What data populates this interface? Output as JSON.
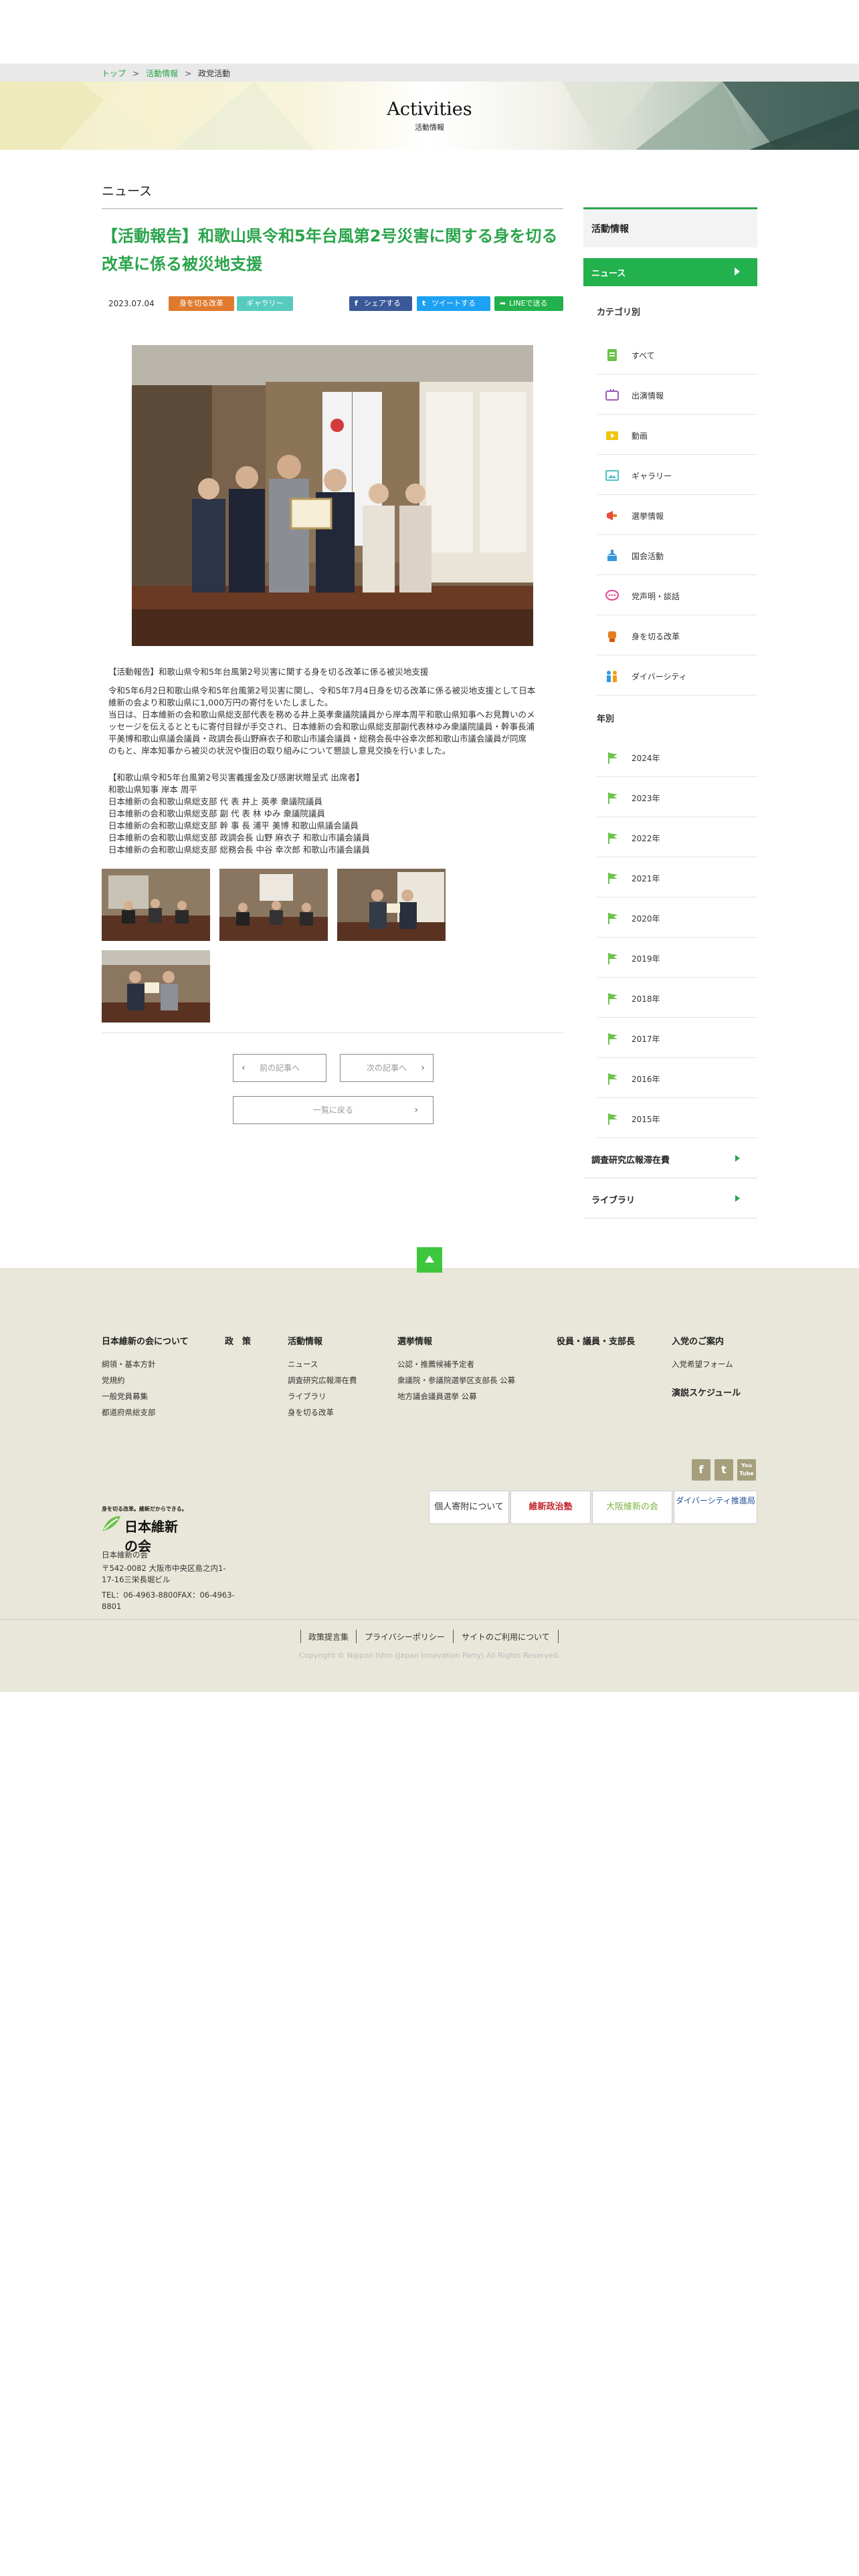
{
  "breadcrumb": {
    "home": "トップ",
    "activities": "活動情報",
    "current": "政党活動",
    "separator": ">"
  },
  "hero": {
    "title": "Activities",
    "subtitle": "活動情報"
  },
  "section_title": "ニュース",
  "article": {
    "title": "【活動報告】和歌山県令和5年台風第2号災害に関する身を切る改革に係る被災地支援",
    "date": "2023.07.04",
    "tags": [
      "身を切る改革",
      "ギャラリー"
    ],
    "share": {
      "facebook": "シェアする",
      "twitter": "ツイートする",
      "line": "LINEで送る"
    },
    "caption": "【活動報告】和歌山県令和5年台風第2号災害に関する身を切る改革に係る被災地支援",
    "paragraph": [
      "令和5年6月2日和歌山県令和5年台風第2号災害に関し、令和5年7月4日身を切る改革に係る被災地支援として日本",
      "維新の会より和歌山県に1,000万円の寄付をいたしました。",
      "当日は、日本維新の会和歌山県総支部代表を務める井上英孝衆議院議員から岸本周平和歌山県知事へお見舞いのメ",
      "ッセージを伝えるとともに寄付目録が手交され、日本維新の会和歌山県総支部副代表林ゆみ衆議院議員・幹事長浦",
      "平美博和歌山県議会議員・政調会長山野麻衣子和歌山市議会議員・総務会長中谷幸次郎和歌山市議会議員が同席",
      "のもと、岸本知事から被災の状況や復旧の取り組みについて懇談し意見交換を行いました。"
    ],
    "attendees": [
      "【和歌山県令和5年台風第2号災害義援金及び感謝状贈呈式 出席者】",
      "和歌山県知事 岸本 周平",
      "日本維新の会和歌山県総支部 代 表 井上 英孝 衆議院議員",
      "日本維新の会和歌山県総支部 副 代 表 林 ゆみ 衆議院議員",
      "日本維新の会和歌山県総支部 幹 事 長 浦平 美博 和歌山県議会議員",
      "日本維新の会和歌山県総支部 政調会長 山野 麻衣子 和歌山市議会議員",
      "日本維新の会和歌山県総支部 総務会長 中谷 幸次郎 和歌山市議会議員"
    ]
  },
  "pager": {
    "prev": "前の記事へ",
    "next": "次の記事へ",
    "list": "一覧に戻る"
  },
  "sidebar": {
    "heading": "活動情報",
    "news": "ニュース",
    "by_category": "カテゴリ別",
    "categories": [
      "すべて",
      "出演情報",
      "動画",
      "ギャラリー",
      "選挙情報",
      "国会活動",
      "党声明・談話",
      "身を切る改革",
      "ダイバーシティ"
    ],
    "by_year": "年別",
    "years": [
      "2024年",
      "2023年",
      "2022年",
      "2021年",
      "2020年",
      "2019年",
      "2018年",
      "2017年",
      "2016年",
      "2015年"
    ],
    "links": [
      "調査研究広報滞在費",
      "ライブラリ"
    ]
  },
  "footer": {
    "columns": [
      {
        "heading": "日本維新の会について",
        "items": [
          "綱領・基本方針",
          "党規約",
          "一般党員募集",
          "都道府県総支部"
        ]
      },
      {
        "heading": "政　策",
        "items": []
      },
      {
        "heading": "活動情報",
        "items": [
          "ニュース",
          "調査研究広報滞在費",
          "ライブラリ",
          "身を切る改革"
        ]
      },
      {
        "heading": "選挙情報",
        "items": [
          "公認・推薦候補予定者",
          "衆議院・参議院選挙区支部長 公募",
          "地方議会議員選挙 公募"
        ]
      },
      {
        "heading": "役員・議員・支部長",
        "items": []
      },
      {
        "heading": "入党のご案内",
        "items": [
          "入党希望フォーム"
        ]
      }
    ],
    "speech_schedule": "演説スケジュール",
    "social": {
      "facebook": "f",
      "twitter": "t",
      "youtube": "You Tube"
    },
    "banners": [
      "個人寄附について",
      "維新政治塾",
      "大阪維新の会",
      "ダイバーシティ推進局"
    ],
    "logo_tagline": "身を切る改革。維新だからできる。",
    "logo_name": "日本維新の会",
    "org_name": "日本維新の会",
    "address": "〒542-0082 大阪市中央区島之内1-17-16三栄長堀ビル",
    "tel": "TEL：06-4963-8800FAX：06-4963-8801",
    "bottom_links": [
      "政策提言集",
      "プライバシーポリシー",
      "サイトのご利用について"
    ],
    "copyright": "Copyright © Nippon Ishin (Japan Innovation Party) All Rights Reserved."
  }
}
